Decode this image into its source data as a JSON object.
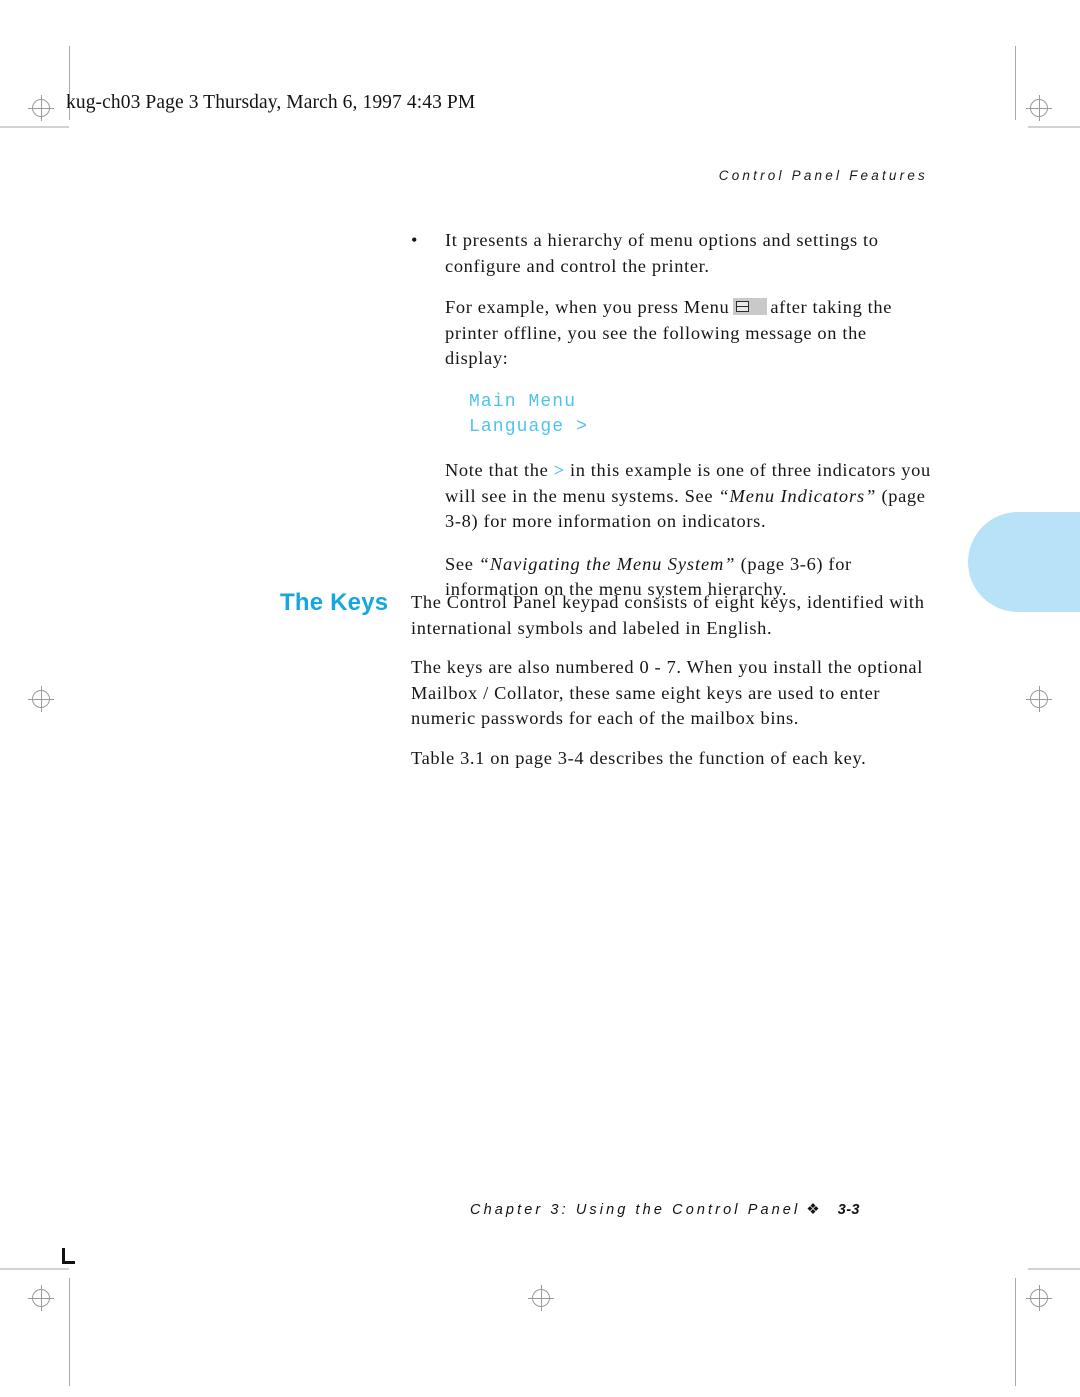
{
  "document": {
    "file_header": "kug-ch03  Page 3  Thursday, March 6, 1997  4:43 PM",
    "running_head": "Control Panel Features"
  },
  "content": {
    "bullet_marker": "•",
    "bullet_paragraph": "It presents a hierarchy of menu options and settings to configure and control the printer.",
    "example_intro_before_key": "For example, when you press Menu",
    "example_intro_after_key": "after taking the printer offline, you see the following message on the display:",
    "lcd": {
      "line1": "Main Menu",
      "line2": "Language >"
    },
    "note_part1": "Note that the",
    "note_indicator": ">",
    "note_part2": "in this example is one of three indicators you will see in the menu systems. See",
    "note_ref_title": "“Menu Indicators”",
    "note_part3": "(page 3-8) for more information on indicators.",
    "see_part1": "See",
    "see_ref_title": "“Navigating the Menu System”",
    "see_part2": "(page 3-6) for information on the menu system hierarchy."
  },
  "section": {
    "heading": "The Keys",
    "paragraph_1": "The Control Panel keypad consists of eight keys, identified with international symbols and labeled in English.",
    "paragraph_2": "The keys are also numbered 0 - 7. When you install the optional Mailbox / Collator, these same eight keys are used to enter numeric passwords for each of the mailbox bins.",
    "paragraph_3": "Table 3.1 on page 3-4 describes the function of each key."
  },
  "footer": {
    "chapter_text": "Chapter 3: Using the Control Panel",
    "separator": "❖",
    "page_number": "3-3"
  },
  "colors": {
    "accent_heading": "#16A6E0",
    "lcd_text": "#4FC3F0",
    "thumb_tab": "#B8E2F8",
    "body_text": "#161616",
    "keycap_face": "#c9c9c9"
  }
}
